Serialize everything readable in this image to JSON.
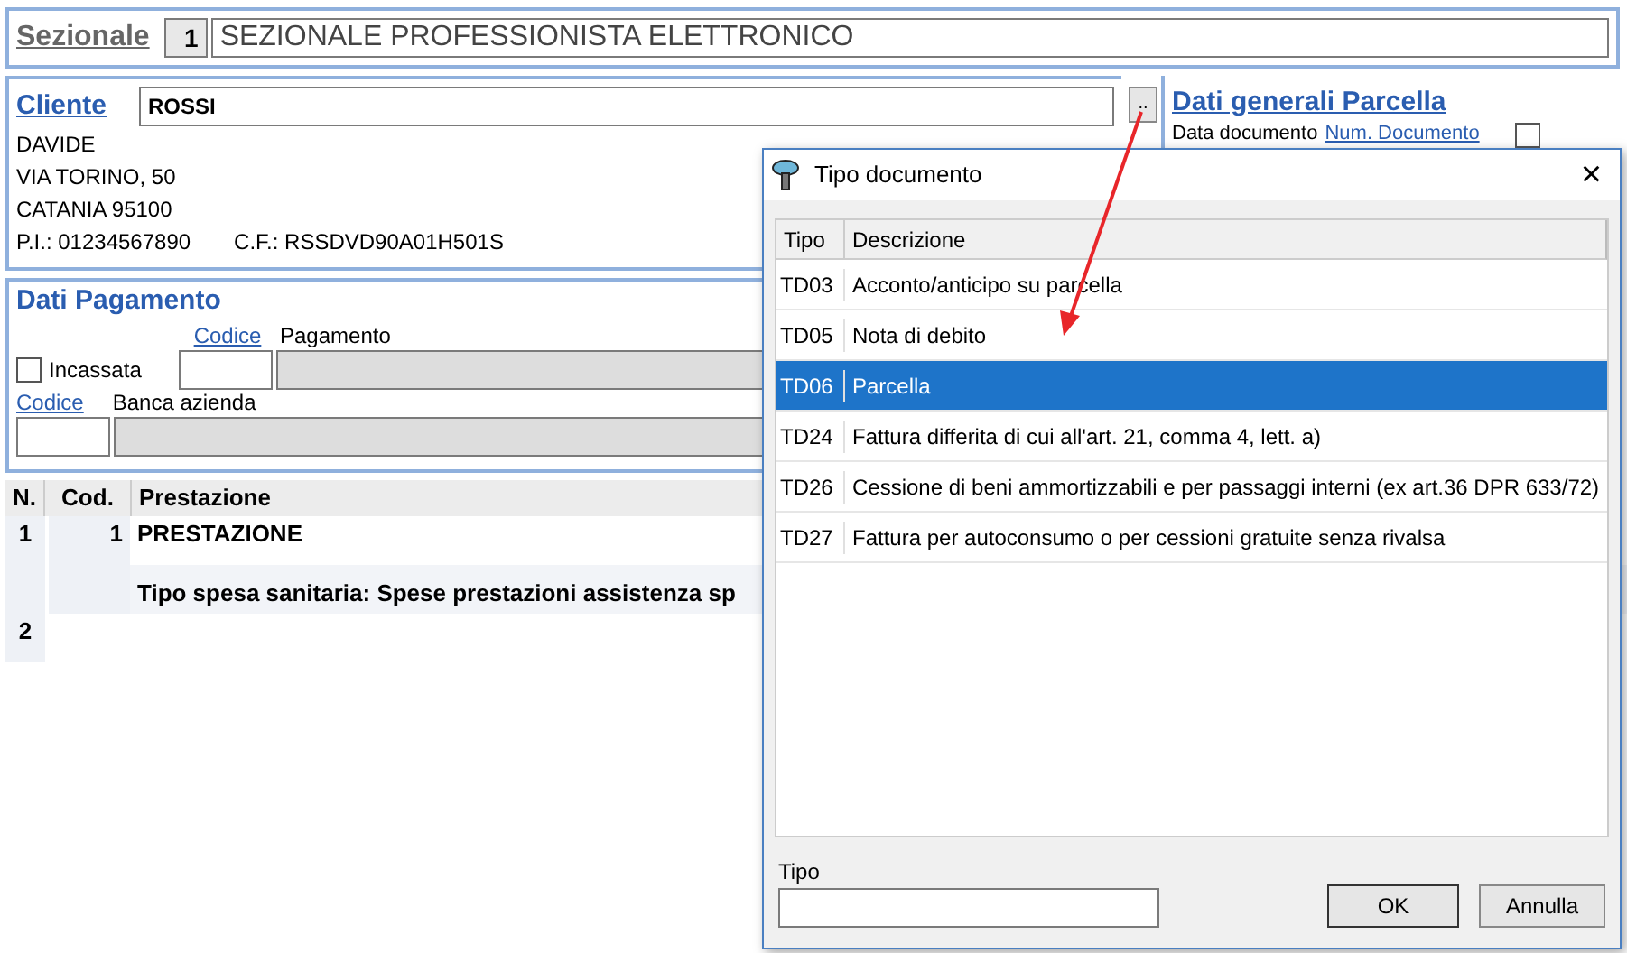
{
  "sezionale": {
    "label": "Sezionale",
    "code": "1",
    "description": "SEZIONALE PROFESSIONISTA ELETTRONICO"
  },
  "cliente": {
    "label": "Cliente",
    "value": "ROSSI",
    "browse": "..",
    "lines": [
      "DAVIDE",
      "VIA TORINO, 50",
      "CATANIA 95100"
    ],
    "piva": "P.I.: 01234567890",
    "cf": "C.F.: RSSDVD90A01H501S"
  },
  "dati_generali": {
    "title": "Dati generali Parcella",
    "data_documento": "Data documento",
    "num_documento": "Num. Documento",
    "checkbox_checked": false
  },
  "dati_pagamento": {
    "title": "Dati Pagamento",
    "incassata": {
      "label": "Incassata",
      "checked": false
    },
    "codice_pagamento": "Codice",
    "pagamento": "Pagamento",
    "codice_banca": "Codice",
    "banca": "Banca azienda"
  },
  "prestazioni": {
    "columns": [
      "N.",
      "Cod.",
      "Prestazione"
    ],
    "rows": [
      {
        "n": "1",
        "cod": "1",
        "text": "PRESTAZIONE"
      },
      {
        "n": "",
        "cod": "",
        "text": "Tipo spesa sanitaria: Spese prestazioni assistenza sp"
      },
      {
        "n": "2",
        "cod": "",
        "text": ""
      }
    ]
  },
  "dialog": {
    "title": "Tipo documento",
    "close": "×",
    "columns": [
      "Tipo",
      "Descrizione"
    ],
    "rows": [
      {
        "tipo": "TD03",
        "descrizione": "Acconto/anticipo su parcella",
        "selected": false
      },
      {
        "tipo": "TD05",
        "descrizione": "Nota di debito",
        "selected": false
      },
      {
        "tipo": "TD06",
        "descrizione": "Parcella",
        "selected": true
      },
      {
        "tipo": "TD24",
        "descrizione": "Fattura differita di cui all'art. 21, comma 4, lett. a)",
        "selected": false
      },
      {
        "tipo": "TD26",
        "descrizione": "Cessione di beni ammortizzabili e per passaggi interni (ex art.36 DPR 633/72)",
        "selected": false
      },
      {
        "tipo": "TD27",
        "descrizione": "Fattura per autoconsumo o per cessioni gratuite senza rivalsa",
        "selected": false
      }
    ],
    "field_label": "Tipo",
    "buttons": [
      "OK",
      "Annulla"
    ]
  }
}
